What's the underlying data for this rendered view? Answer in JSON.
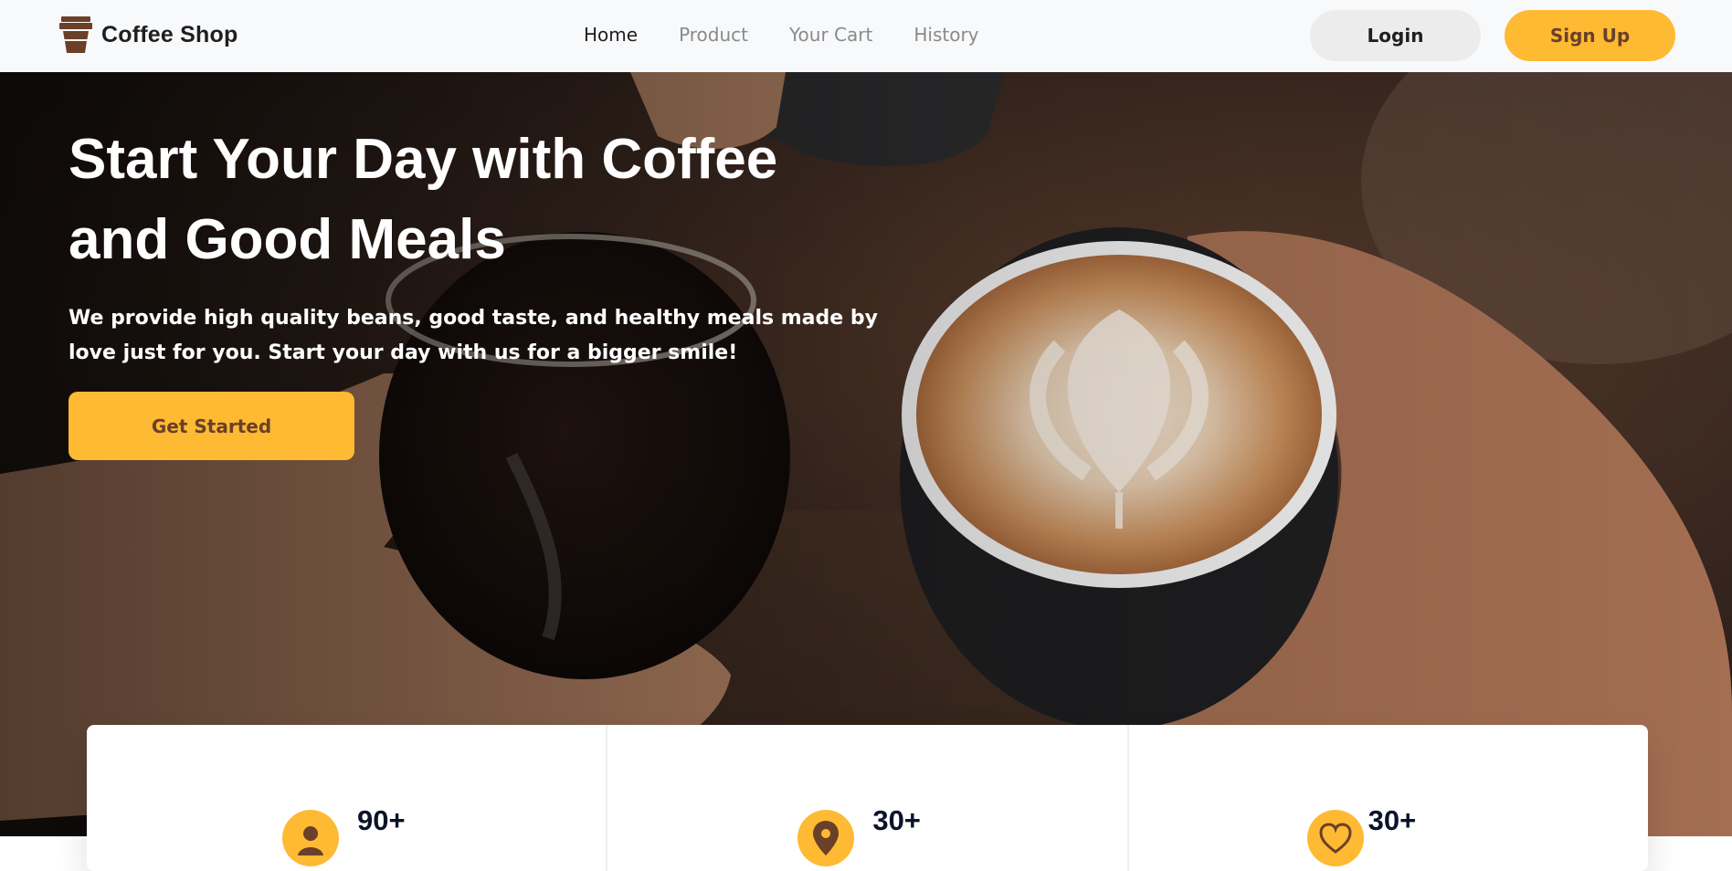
{
  "brand": {
    "name": "Coffee Shop",
    "icon": "coffee-cup-icon"
  },
  "nav": {
    "links": [
      {
        "label": "Home",
        "active": true
      },
      {
        "label": "Product",
        "active": false
      },
      {
        "label": "Your Cart",
        "active": false
      },
      {
        "label": "History",
        "active": false
      }
    ],
    "login_label": "Login",
    "signup_label": "Sign Up"
  },
  "hero": {
    "title": "Start Your Day with Coffee and Good Meals",
    "subtitle": "We provide high quality beans, good taste, and healthy meals made by love just for you. Start your day with us for a bigger smile!",
    "cta_label": "Get Started",
    "image": "coffee-cheers-photo"
  },
  "stats": [
    {
      "value": "90+",
      "icon": "user-icon"
    },
    {
      "value": "30+",
      "icon": "location-pin-icon"
    },
    {
      "value": "30+",
      "icon": "heart-icon"
    }
  ],
  "colors": {
    "accent": "#ffba33",
    "brown": "#6a4029",
    "nav_bg": "#f8f9fb",
    "text_dark": "#0b132a"
  }
}
